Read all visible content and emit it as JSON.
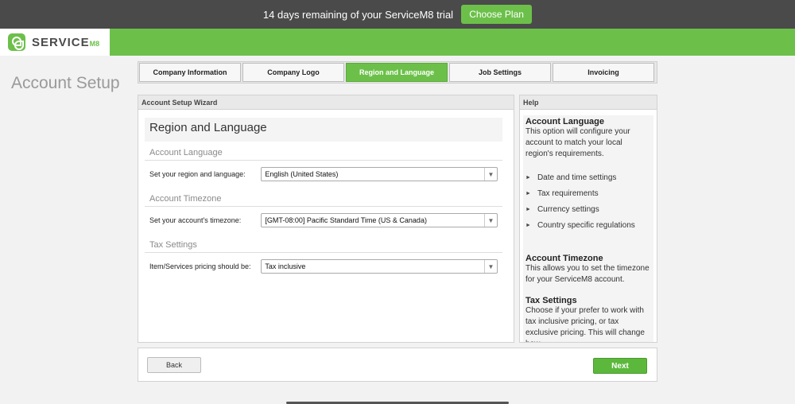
{
  "banner": {
    "trial_text": "14 days remaining of your ServiceM8 trial",
    "choose_plan": "Choose Plan"
  },
  "brand": {
    "name": "SERVICE",
    "suffix": "M8"
  },
  "page_title": "Account Setup",
  "tabs": [
    {
      "label": "Company Information",
      "active": false
    },
    {
      "label": "Company Logo",
      "active": false
    },
    {
      "label": "Region and Language",
      "active": true
    },
    {
      "label": "Job Settings",
      "active": false
    },
    {
      "label": "Invoicing",
      "active": false
    }
  ],
  "wizard": {
    "header": "Account Setup Wizard",
    "title": "Region and Language",
    "sections": [
      {
        "heading": "Account Language",
        "label": "Set your region and language:",
        "value": "English (United States)"
      },
      {
        "heading": "Account Timezone",
        "label": "Set your account's timezone:",
        "value": "[GMT-08:00] Pacific Standard Time (US & Canada)"
      },
      {
        "heading": "Tax Settings",
        "label": "Item/Services pricing should be:",
        "value": "Tax inclusive"
      }
    ]
  },
  "help": {
    "header": "Help",
    "language_title": "Account Language",
    "language_text": "This option will configure your account to match your local region's requirements.",
    "bullets": [
      "Date and time settings",
      "Tax requirements",
      "Currency settings",
      "Country specific regulations"
    ],
    "timezone_title": "Account Timezone",
    "timezone_text": "This allows you to set the timezone for your ServiceM8 account.",
    "tax_title": "Tax Settings",
    "tax_text": "Choose if your prefer to work with tax inclusive pricing, or tax exclusive pricing. This will change how"
  },
  "footer": {
    "back": "Back",
    "next": "Next"
  },
  "colors": {
    "brand_green": "#6cc04a",
    "banner_dark": "#4a4a4a"
  }
}
